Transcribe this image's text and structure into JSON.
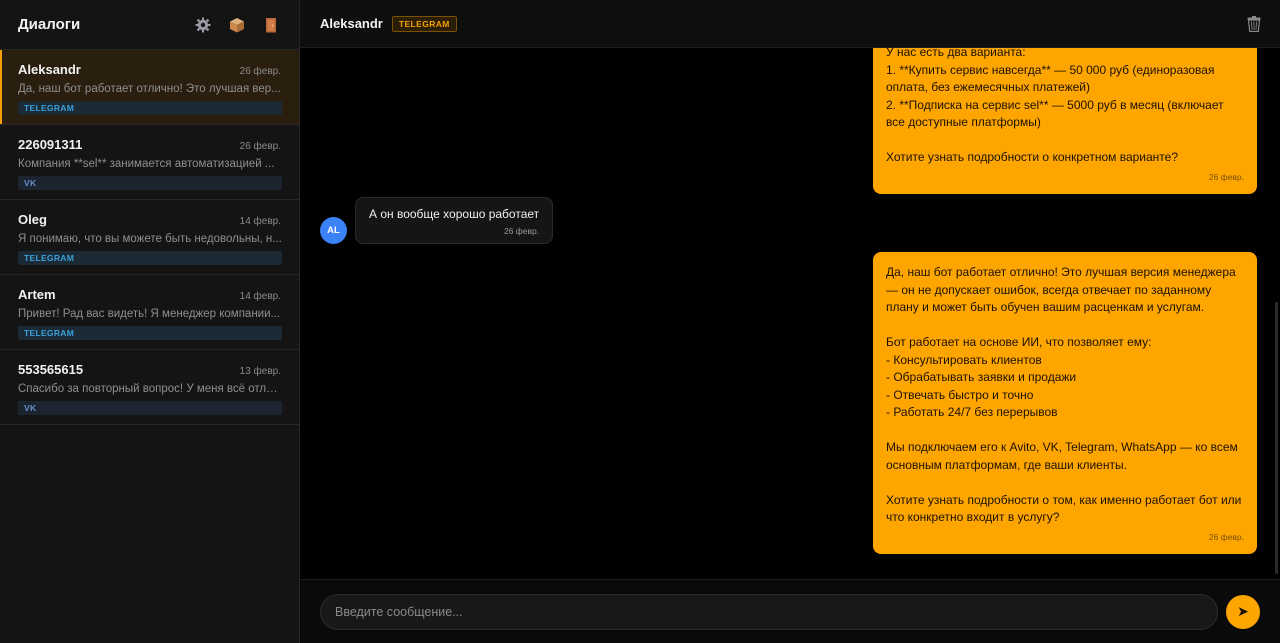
{
  "sidebar": {
    "title": "Диалоги",
    "icons": {
      "settings": "gear-icon",
      "box": "package-icon",
      "logout": "door-icon"
    },
    "items": [
      {
        "name": "Aleksandr",
        "date": "26 февр.",
        "preview": "Да, наш бот работает отлично! Это лучшая вер...",
        "tag": "TELEGRAM",
        "active": true
      },
      {
        "name": "226091311",
        "date": "26 февр.",
        "preview": "Компания **sel** занимается автоматизацией ...",
        "tag": "VK",
        "active": false
      },
      {
        "name": "Oleg",
        "date": "14 февр.",
        "preview": "Я понимаю, что вы можете быть недовольны, н...",
        "tag": "TELEGRAM",
        "active": false
      },
      {
        "name": "Artem",
        "date": "14 февр.",
        "preview": "Привет! Рад вас видеть! Я менеджер компании...",
        "tag": "TELEGRAM",
        "active": false
      },
      {
        "name": "553565615",
        "date": "13 февр.",
        "preview": "Спасибо за повторный вопрос! У меня всё отли...",
        "tag": "VK",
        "active": false
      }
    ]
  },
  "chat": {
    "name": "Aleksandr",
    "badge": "TELEGRAM",
    "trash_icon": "trash-icon",
    "messages": [
      {
        "direction": "out",
        "text": "У нас есть два варианта:\n1. **Купить сервис навсегда** — 50 000 руб (единоразовая оплата, без ежемесячных платежей)\n2. **Подписка на сервис sel** — 5000 руб в месяц (включает все доступные платформы)\n\nХотите узнать подробности о конкретном варианте?",
        "time": "26 февр."
      },
      {
        "direction": "in",
        "avatar": "AL",
        "text": "А он вообще хорошо работает",
        "time": "26 февр."
      },
      {
        "direction": "out",
        "text": "Да, наш бот работает отлично! Это лучшая версия менеджера — он не допускает ошибок, всегда отвечает по заданному плану и может быть обучен вашим расценкам и услугам.\n\nБот работает на основе ИИ, что позволяет ему:\n- Консультировать клиентов\n- Обрабатывать заявки и продажи\n- Отвечать быстро и точно\n- Работать 24/7 без перерывов\n\nМы подключаем его к Avito, VK, Telegram, WhatsApp — ко всем основным платформам, где ваши клиенты.\n\nХотите узнать подробности о том, как именно работает бот или что конкретно входит в услугу?",
        "time": "26 февр."
      }
    ]
  },
  "composer": {
    "placeholder": "Введите сообщение...",
    "send_icon": "send-icon",
    "send_glyph": "➤"
  },
  "colors": {
    "accent": "#ffa500",
    "telegram": "#3aa0dc",
    "vk": "#6a8fcc",
    "avatar": "#3b82f6"
  }
}
